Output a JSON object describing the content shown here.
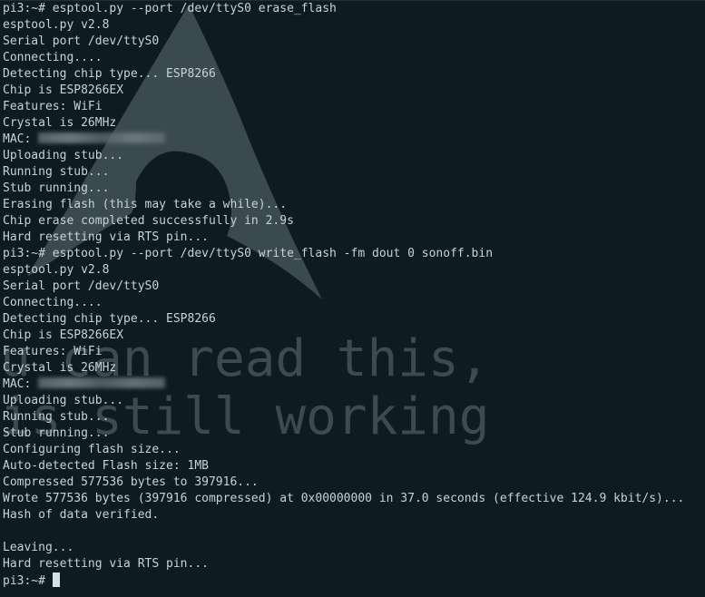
{
  "wallpaper": {
    "text_line1": "u can read this,",
    "text_line2": "is still working"
  },
  "terminal": {
    "lines": [
      "pi3:~# esptool.py --port /dev/ttyS0 erase_flash",
      "esptool.py v2.8",
      "Serial port /dev/ttyS0",
      "Connecting....",
      "Detecting chip type... ESP8266",
      "Chip is ESP8266EX",
      "Features: WiFi",
      "Crystal is 26MHz",
      "MAC: ",
      "Uploading stub...",
      "Running stub...",
      "Stub running...",
      "Erasing flash (this may take a while)...",
      "Chip erase completed successfully in 2.9s",
      "Hard resetting via RTS pin...",
      "pi3:~# esptool.py --port /dev/ttyS0 write_flash -fm dout 0 sonoff.bin",
      "esptool.py v2.8",
      "Serial port /dev/ttyS0",
      "Connecting....",
      "Detecting chip type... ESP8266",
      "Chip is ESP8266EX",
      "Features: WiFi",
      "Crystal is 26MHz",
      "MAC: ",
      "Uploading stub...",
      "Running stub...",
      "Stub running...",
      "Configuring flash size...",
      "Auto-detected Flash size: 1MB",
      "Compressed 577536 bytes to 397916...",
      "Wrote 577536 bytes (397916 compressed) at 0x00000000 in 37.0 seconds (effective 124.9 kbit/s)...",
      "Hash of data verified.",
      "",
      "Leaving...",
      "Hard resetting via RTS pin...",
      "pi3:~# "
    ]
  },
  "colors": {
    "background": "#0e1b20",
    "text": "#c7d3d6",
    "logo": "#4b5b60"
  }
}
